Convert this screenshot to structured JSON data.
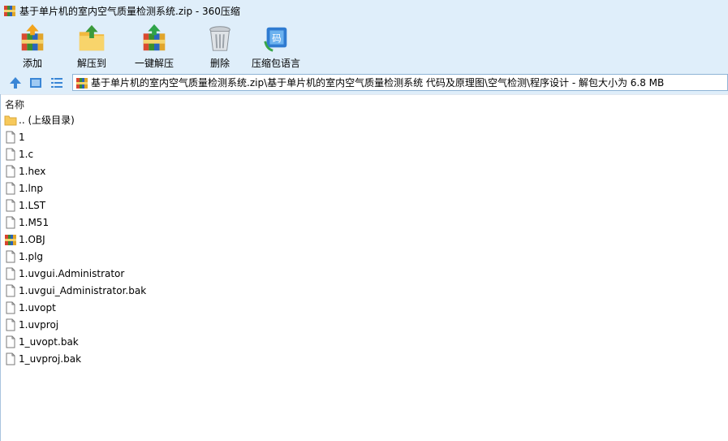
{
  "window": {
    "title": "基于单片机的室内空气质量检测系统.zip - 360压缩",
    "app_icon": "archive-icon"
  },
  "toolbar": {
    "items": [
      {
        "label": "添加",
        "icon": "add-archive-icon"
      },
      {
        "label": "解压到",
        "icon": "extract-to-folder-icon"
      },
      {
        "label": "一键解压",
        "icon": "one-click-extract-icon"
      },
      {
        "label": "删除",
        "icon": "trash-icon"
      },
      {
        "label": "压缩包语言",
        "icon": "archive-language-icon"
      }
    ]
  },
  "addressbar": {
    "path": "基于单片机的室内空气质量检测系统.zip\\基于单片机的室内空气质量检测系统 代码及原理图\\空气检测\\程序设计 - 解包大小为 6.8 MB",
    "nav_icons": [
      "up-arrow-icon",
      "large-icons-view-icon",
      "list-view-icon"
    ]
  },
  "columns": {
    "name": "名称"
  },
  "files": [
    {
      "name": ".. (上级目录)",
      "type": "folder"
    },
    {
      "name": "1",
      "type": "file"
    },
    {
      "name": "1.c",
      "type": "file"
    },
    {
      "name": "1.hex",
      "type": "file"
    },
    {
      "name": "1.lnp",
      "type": "file"
    },
    {
      "name": "1.LST",
      "type": "file"
    },
    {
      "name": "1.M51",
      "type": "file"
    },
    {
      "name": "1.OBJ",
      "type": "archive"
    },
    {
      "name": "1.plg",
      "type": "file"
    },
    {
      "name": "1.uvgui.Administrator",
      "type": "file"
    },
    {
      "name": "1.uvgui_Administrator.bak",
      "type": "file"
    },
    {
      "name": "1.uvopt",
      "type": "file"
    },
    {
      "name": "1.uvproj",
      "type": "file"
    },
    {
      "name": "1_uvopt.bak",
      "type": "file"
    },
    {
      "name": "1_uvproj.bak",
      "type": "file"
    }
  ],
  "colors": {
    "chrome_bg": "#dfeefa",
    "folder": "#f7c95b",
    "nav_blue": "#3a86d6"
  }
}
